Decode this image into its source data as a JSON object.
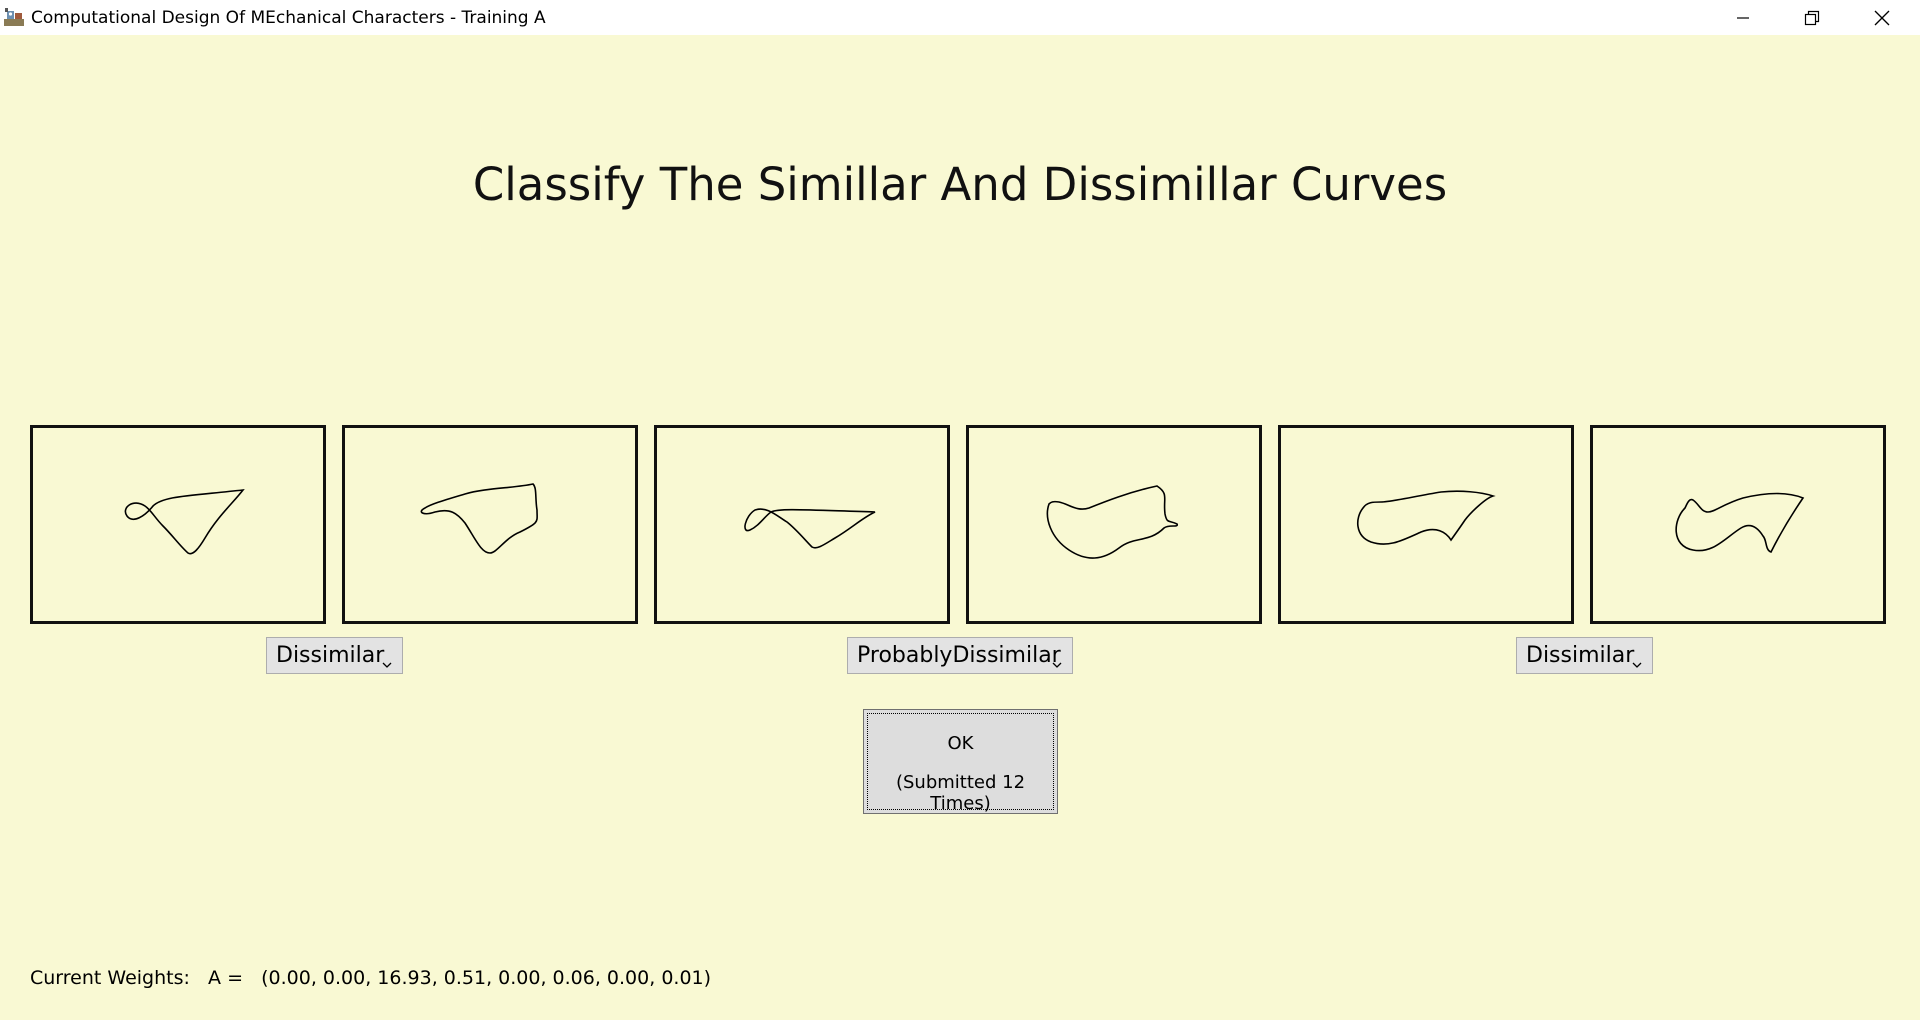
{
  "window": {
    "title": "Computational Design Of MEchanical Characters - Training A",
    "app_icon": "gear-robot-icon",
    "controls": [
      "minimize-icon",
      "restore-icon",
      "close-icon"
    ]
  },
  "main": {
    "heading": "Classify The Simillar And Dissimillar Curves",
    "curve_pairs": [
      {
        "selection": "Dissimilar",
        "options": [
          "Dissimilar"
        ]
      },
      {
        "selection": "ProbablyDissimilar",
        "options": [
          "ProbablyDissimilar"
        ]
      },
      {
        "selection": "Dissimilar",
        "options": [
          "Dissimilar"
        ]
      }
    ],
    "ok_button": {
      "line1": "OK",
      "line2": "(Submitted 12 Times)"
    },
    "weights": {
      "label": "Current Weights:",
      "var": "A =",
      "values": "(0.00, 0.00, 16.93, 0.51, 0.00, 0.06, 0.00, 0.01)"
    }
  },
  "colors": {
    "background": "#F9F9D3",
    "border": "#111111",
    "select_bg": "#E3E3E3",
    "button_bg": "#DDDDDD"
  }
}
